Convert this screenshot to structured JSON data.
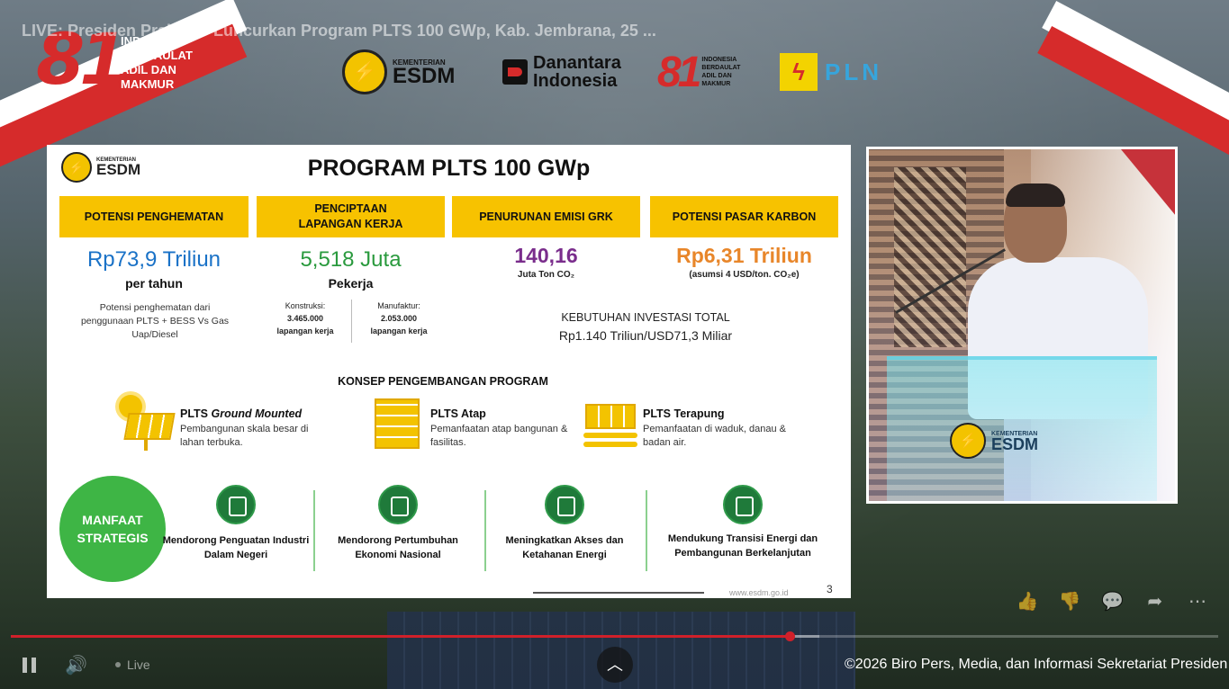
{
  "video": {
    "title": "LIVE: Presiden Prabowo Luncurkan Program PLTS 100 GWp, Kab. Jembrana, 25 ...",
    "live_label": "Live",
    "copyright": "©2026 Biro Pers, Media, dan Informasi Sekretariat Presiden",
    "progress_fraction": 0.645,
    "buffer_fraction": 0.67
  },
  "banner": {
    "logo81_number": "81",
    "logo81_text": "INDONESIA BERDAULAT ADIL DAN MAKMUR",
    "esdm_small": "KEMENTERIAN",
    "esdm_big": "ESDM",
    "danantara": "Danantara Indonesia",
    "small81_number": "81",
    "small81_text": "INDONESIA BERDAULAT ADIL DAN MAKMUR",
    "pln": "PLN"
  },
  "slide": {
    "logo_small": "KEMENTERIAN",
    "logo_big": "ESDM",
    "title": "PROGRAM PLTS 100 GWp",
    "metrics": [
      {
        "header": "POTENSI PENGHEMATAN",
        "value": "Rp73,9 Triliun",
        "sub": "per tahun",
        "desc": "Potensi penghematan dari penggunaan PLTS + BESS Vs Gas Uap/Diesel"
      },
      {
        "header": "PENCIPTAAN LAPANGAN KERJA",
        "value": "5,518 Juta",
        "sub": "Pekerja",
        "split": [
          {
            "label": "Konstruksi:",
            "num": "3.465.000",
            "unit": "lapangan kerja"
          },
          {
            "label": "Manufaktur:",
            "num": "2.053.000",
            "unit": "lapangan kerja"
          }
        ]
      },
      {
        "header": "PENURUNAN EMISI GRK",
        "value": "140,16",
        "sub": "Juta Ton CO₂"
      },
      {
        "header": "POTENSI PASAR KARBON",
        "value": "Rp6,31 Triliun",
        "sub": "(asumsi 4 USD/ton. CO₂e)"
      }
    ],
    "investment_label": "KEBUTUHAN INVESTASI TOTAL",
    "investment_value": "Rp1.140 Triliun/USD71,3 Miliar",
    "konsep_title": "KONSEP PENGEMBANGAN PROGRAM",
    "konsep": [
      {
        "title_a": "PLTS ",
        "title_b": "Ground Mounted",
        "desc": "Pembangunan skala besar di lahan terbuka."
      },
      {
        "title_a": "PLTS Atap",
        "title_b": "",
        "desc": "Pemanfaatan atap bangunan & fasilitas."
      },
      {
        "title_a": "PLTS Terapung",
        "title_b": "",
        "desc": "Pemanfaatan di waduk, danau & badan air."
      }
    ],
    "manfaat": "MANFAAT STRATEGIS",
    "benefits": [
      "Mendorong Penguatan Industri Dalam Negeri",
      "Mendorong Pertumbuhan Ekonomi Nasional",
      "Meningkatkan Akses dan Ketahanan Energi",
      "Mendukung Transisi Energi dan Pembangunan Berkelanjutan"
    ],
    "page_number": "3",
    "url": "www.esdm.go.id"
  },
  "speaker": {
    "podium_small": "KEMENTERIAN",
    "podium_big": "ESDM"
  },
  "actions": {
    "like": "👍",
    "dislike": "👎",
    "comment": "💬",
    "share": "➦",
    "more": "⋯"
  },
  "colors": {
    "accent_yellow": "#f7c200",
    "accent_red": "#d0202a",
    "green": "#3eb545"
  }
}
